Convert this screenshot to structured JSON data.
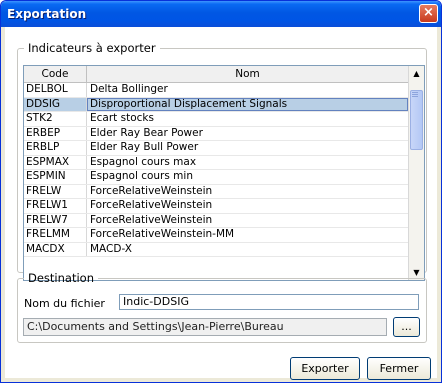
{
  "window": {
    "title": "Exportation",
    "close_label": "×"
  },
  "indicators": {
    "legend": "Indicateurs à exporter",
    "columns": {
      "code": "Code",
      "name": "Nom"
    },
    "rows": [
      {
        "code": "DELBOL",
        "name": "Delta Bollinger"
      },
      {
        "code": "DDSIG",
        "name": "Disproportional Displacement Signals",
        "selected": true
      },
      {
        "code": "STK2",
        "name": "Ecart stocks"
      },
      {
        "code": "ERBEP",
        "name": "Elder Ray Bear Power"
      },
      {
        "code": "ERBLP",
        "name": "Elder Ray Bull Power"
      },
      {
        "code": "ESPMAX",
        "name": "Espagnol cours max"
      },
      {
        "code": "ESPMIN",
        "name": "Espagnol cours min"
      },
      {
        "code": "FRELW",
        "name": "ForceRelativeWeinstein"
      },
      {
        "code": "FRELW1",
        "name": "ForceRelativeWeinstein"
      },
      {
        "code": "FRELW7",
        "name": "ForceRelativeWeinstein"
      },
      {
        "code": "FRELMM",
        "name": "ForceRelativeWeinstein-MM"
      },
      {
        "code": "MACDX",
        "name": "MACD-X"
      }
    ],
    "scroll_up_icon": "arrow-up-icon",
    "scroll_down_icon": "arrow-down-icon"
  },
  "destination": {
    "legend": "Destination",
    "filename_label": "Nom du fichier",
    "filename_value": "Indic-DDSIG",
    "path_value": "C:\\Documents and Settings\\Jean-Pierre\\Bureau",
    "browse_label": "..."
  },
  "buttons": {
    "export": "Exporter",
    "close": "Fermer"
  }
}
